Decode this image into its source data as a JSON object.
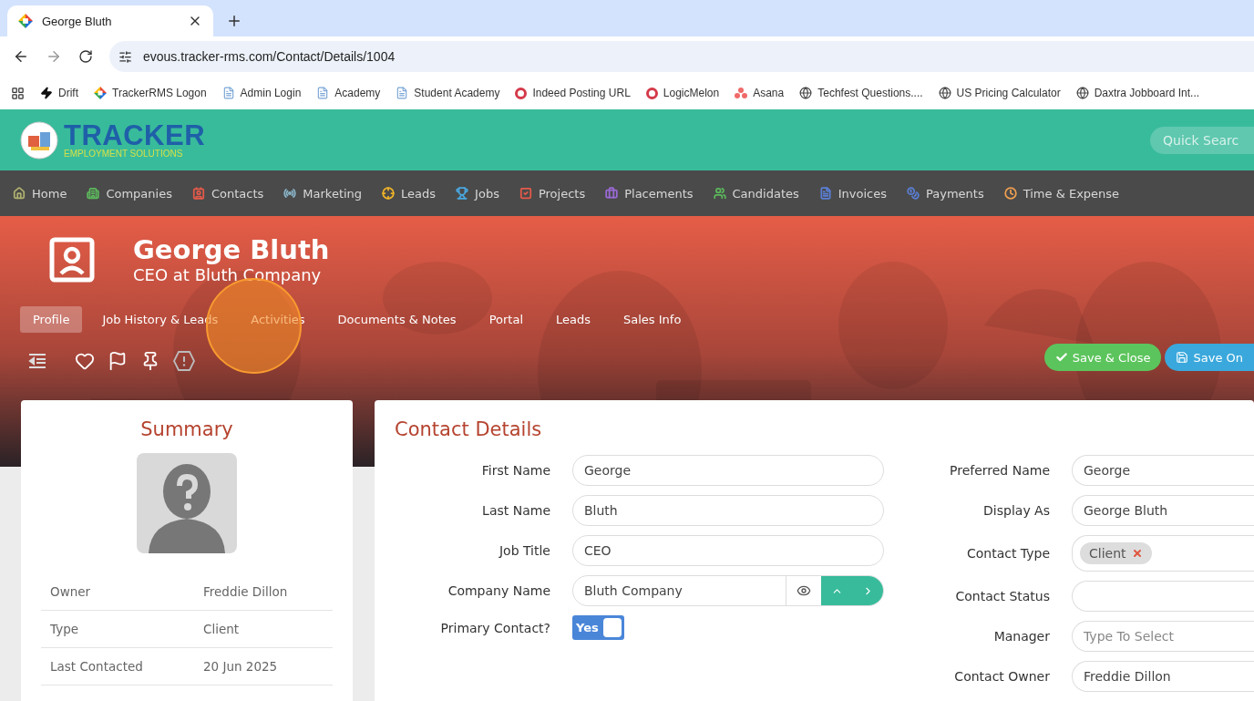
{
  "browser": {
    "tab_title": "George Bluth",
    "url": "evous.tracker-rms.com/Contact/Details/1004",
    "bookmarks": [
      {
        "label": "Drift"
      },
      {
        "label": "TrackerRMS Logon"
      },
      {
        "label": "Admin Login"
      },
      {
        "label": "Academy"
      },
      {
        "label": "Student Academy"
      },
      {
        "label": "Indeed Posting URL"
      },
      {
        "label": "LogicMelon"
      },
      {
        "label": "Asana"
      },
      {
        "label": "Techfest Questions...."
      },
      {
        "label": "US Pricing Calculator"
      },
      {
        "label": "Daxtra Jobboard Int..."
      }
    ]
  },
  "header": {
    "logo_title": "TRACKER",
    "logo_tagline": "EMPLOYMENT SOLUTIONS",
    "search_placeholder": "Quick Searc"
  },
  "navigation": [
    {
      "label": "Home",
      "color": "#b0b070"
    },
    {
      "label": "Companies",
      "color": "#5cb85c"
    },
    {
      "label": "Contacts",
      "color": "#e55a4a"
    },
    {
      "label": "Marketing",
      "color": "#8ab4c8"
    },
    {
      "label": "Leads",
      "color": "#f0b429"
    },
    {
      "label": "Jobs",
      "color": "#4aa8e0"
    },
    {
      "label": "Projects",
      "color": "#e55a4a"
    },
    {
      "label": "Placements",
      "color": "#9a6ad6"
    },
    {
      "label": "Candidates",
      "color": "#5cb85c"
    },
    {
      "label": "Invoices",
      "color": "#5b7fd6"
    },
    {
      "label": "Payments",
      "color": "#5b7fd6"
    },
    {
      "label": "Time & Expense",
      "color": "#f0a050"
    }
  ],
  "contact": {
    "name": "George Bluth",
    "subtitle": "CEO at Bluth Company",
    "tabs": [
      {
        "label": "Profile",
        "selected": true
      },
      {
        "label": "Job History & Leads",
        "selected": false
      },
      {
        "label": "Activities",
        "selected": false
      },
      {
        "label": "Documents & Notes",
        "selected": false
      },
      {
        "label": "Portal",
        "selected": false
      },
      {
        "label": "Leads",
        "selected": false
      },
      {
        "label": "Sales Info",
        "selected": false
      }
    ],
    "buttons": [
      {
        "label": "Save & Close",
        "kind": "success"
      },
      {
        "label": "Save On",
        "kind": "primary"
      }
    ]
  },
  "summary": {
    "title": "Summary",
    "rows": [
      {
        "label": "Owner",
        "value": "Freddie Dillon"
      },
      {
        "label": "Type",
        "value": "Client"
      },
      {
        "label": "Last Contacted",
        "value": "20 Jun 2025"
      }
    ]
  },
  "details": {
    "title": "Contact Details",
    "left_fields": [
      {
        "kind": "text",
        "label": "First Name",
        "value": "George"
      },
      {
        "kind": "text",
        "label": "Last Name",
        "value": "Bluth"
      },
      {
        "kind": "text",
        "label": "Job Title",
        "value": "CEO"
      },
      {
        "kind": "lookup",
        "label": "Company Name",
        "value": "Bluth Company"
      },
      {
        "kind": "toggle",
        "label": "Primary Contact?",
        "text": "Yes",
        "on": true
      }
    ],
    "right_fields": [
      {
        "kind": "text",
        "label": "Preferred Name",
        "value": "George"
      },
      {
        "kind": "text",
        "label": "Display As",
        "value": "George Bluth"
      },
      {
        "kind": "tags",
        "label": "Contact Type",
        "tags": [
          "Client"
        ]
      },
      {
        "kind": "text",
        "label": "Contact Status"
      },
      {
        "kind": "text",
        "label": "Manager",
        "placeholder": "Type To Select"
      },
      {
        "kind": "text",
        "label": "Contact Owner",
        "value": "Freddie Dillon"
      }
    ]
  }
}
